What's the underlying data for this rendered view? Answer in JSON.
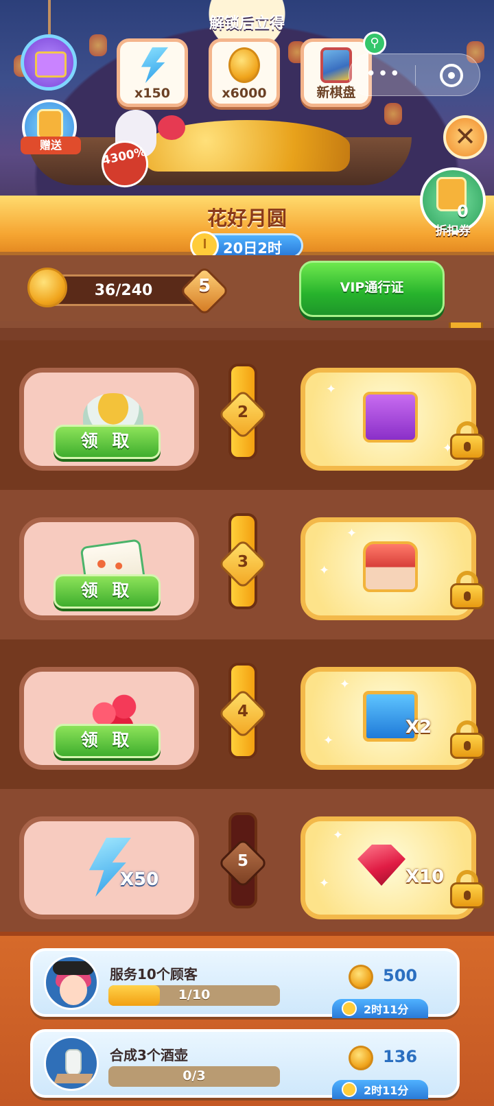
{
  "banner": {
    "unlock_title": "解锁后立得",
    "rewards": [
      {
        "icon": "energy-bolt-icon",
        "label": "x150"
      },
      {
        "icon": "mooncake-coin-icon",
        "label": "x6000"
      },
      {
        "icon": "board-thumbnail-icon",
        "label": "新棋盘"
      }
    ],
    "gift_label": "赠送",
    "percent_badge": "4300%",
    "coupon_count": "0",
    "coupon_label": "折扣券"
  },
  "capsule": {
    "more": "•••"
  },
  "event": {
    "title": "花好月圆",
    "timer": "20日2时"
  },
  "progress": {
    "value": "36/240",
    "level": "5",
    "vip_button": "VIP通行证"
  },
  "reward_rows": [
    {
      "level": "2",
      "free_item": "soup-bowl-icon",
      "free_mult": "",
      "claim": "领 取",
      "vip_item": "purple-chest-icon",
      "vip_mult": "",
      "unlocked": true
    },
    {
      "level": "3",
      "free_item": "shrimp-rice-icon",
      "free_mult": "",
      "claim": "领 取",
      "vip_item": "mystery-chest-icon",
      "vip_mult": "",
      "unlocked": true
    },
    {
      "level": "4",
      "free_item": "rubies-icon",
      "free_mult": "",
      "claim": "领 取",
      "vip_item": "blue-chest-icon",
      "vip_mult": "X2",
      "unlocked": true
    },
    {
      "level": "5",
      "free_item": "energy-bolt-icon",
      "free_mult": "X50",
      "claim": "",
      "vip_item": "ruby-icon",
      "vip_mult": "X10",
      "unlocked": false
    }
  ],
  "tasks": [
    {
      "name": "服务10个顾客",
      "progress_text": "1/10",
      "progress_fraction": 0.1,
      "reward": "500",
      "time": "2时11分"
    },
    {
      "name": "合成3个酒壶",
      "progress_text": "0/3",
      "progress_fraction": 0,
      "reward": "136",
      "time": "2时11分"
    }
  ]
}
